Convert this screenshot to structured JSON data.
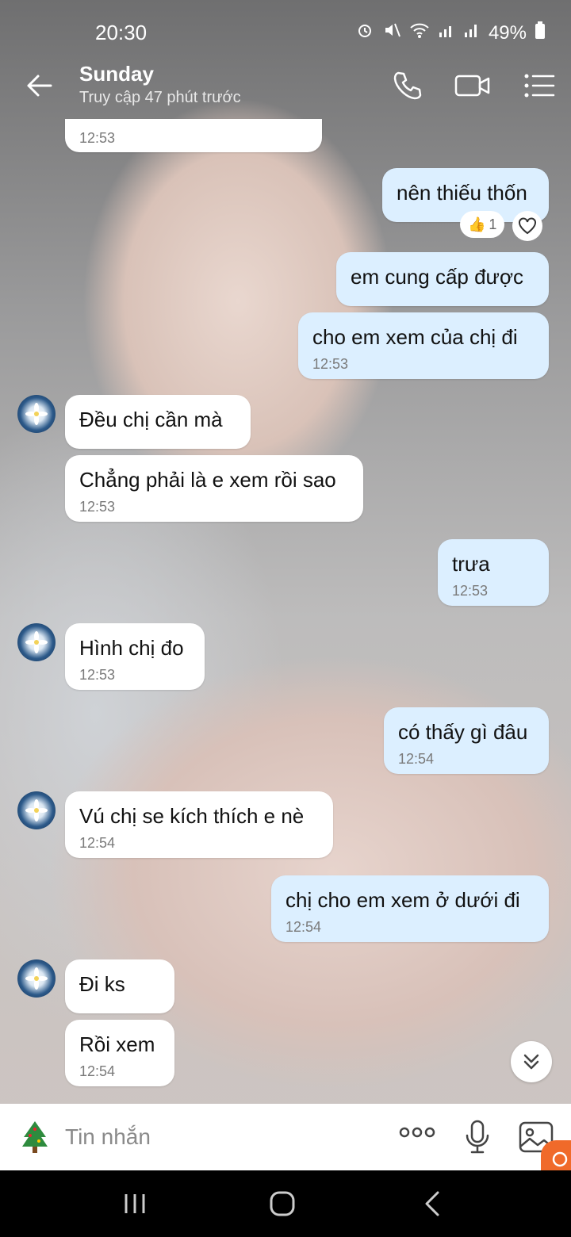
{
  "status_bar": {
    "time": "20:30",
    "battery": "49%",
    "icons": [
      "alarm-icon",
      "mute-icon",
      "wifi-icon",
      "signal-icon",
      "signal-icon",
      "battery-icon"
    ]
  },
  "header": {
    "name": "Sunday",
    "status": "Truy cập 47 phút trước",
    "icons": [
      "back-arrow-icon",
      "phone-icon",
      "video-call-icon",
      "menu-icon"
    ]
  },
  "messages": [
    {
      "side": "recv",
      "text": "",
      "time": "12:53"
    },
    {
      "side": "sent",
      "text": "nên thiếu thốn",
      "time": ""
    },
    {
      "side": "sent",
      "text": "em cung cấp được",
      "time": ""
    },
    {
      "side": "sent",
      "text": "cho em xem của chị đi",
      "time": "12:53"
    },
    {
      "side": "recv",
      "text": "Đều chị cần mà",
      "time": ""
    },
    {
      "side": "recv",
      "text": "Chẳng phải là e xem rồi sao",
      "time": "12:53"
    },
    {
      "side": "sent",
      "text": "trưa",
      "time": "12:53"
    },
    {
      "side": "recv",
      "text": "Hình chị đo",
      "time": "12:53"
    },
    {
      "side": "sent",
      "text": "có thấy gì đâu",
      "time": "12:54"
    },
    {
      "side": "recv",
      "text": "Vú chị se kích thích e nè",
      "time": "12:54"
    },
    {
      "side": "sent",
      "text": "chị cho em xem ở dưới đi",
      "time": "12:54"
    },
    {
      "side": "recv",
      "text": "Đi ks",
      "time": ""
    },
    {
      "side": "recv",
      "text": "Rồi xem",
      "time": "12:54"
    }
  ],
  "reaction": {
    "emoji": "👍",
    "count": "1"
  },
  "composer": {
    "placeholder": "Tin nhắn"
  },
  "colors": {
    "sent_bubble": "#dcefff",
    "recv_bubble": "#ffffff",
    "timestamp": "#7a7a7a"
  }
}
